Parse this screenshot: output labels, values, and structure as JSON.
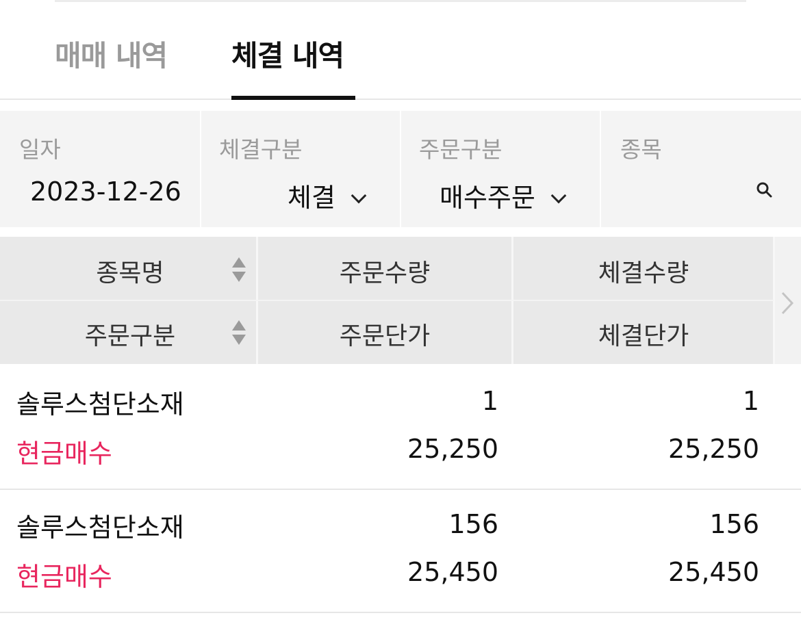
{
  "tabs": [
    {
      "label": "매매 내역",
      "active": false
    },
    {
      "label": "체결 내역",
      "active": true
    }
  ],
  "filters": {
    "date": {
      "label": "일자",
      "value": "2023-12-26"
    },
    "exec_type": {
      "label": "체결구분",
      "value": "체결"
    },
    "order_type": {
      "label": "주문구분",
      "value": "매수주문"
    },
    "stock": {
      "label": "종목",
      "value": ""
    }
  },
  "table": {
    "headers": {
      "col1_top": "종목명",
      "col1_bottom": "주문구분",
      "col2_top": "주문수량",
      "col2_bottom": "주문단가",
      "col3_top": "체결수량",
      "col3_bottom": "체결단가"
    },
    "rows": [
      {
        "name": "솔루스첨단소재",
        "order_type": "현금매수",
        "order_qty": "1",
        "order_price": "25,250",
        "exec_qty": "1",
        "exec_price": "25,250"
      },
      {
        "name": "솔루스첨단소재",
        "order_type": "현금매수",
        "order_qty": "156",
        "order_price": "25,450",
        "exec_qty": "156",
        "exec_price": "25,450"
      }
    ]
  },
  "colors": {
    "accent_buy": "#e8265e",
    "header_bg": "#e9e9e9",
    "filter_bg": "#f4f4f4"
  },
  "icons": [
    "search-icon",
    "chevron-down-icon",
    "sort-icon",
    "chevron-right-icon"
  ]
}
